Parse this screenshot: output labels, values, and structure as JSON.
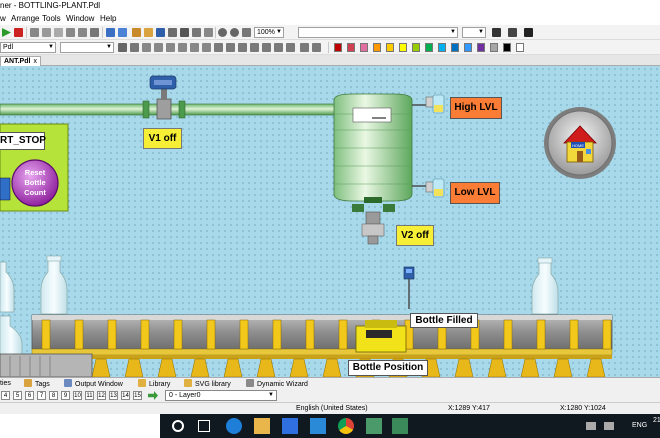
{
  "window": {
    "title": "ner - BOTTLING-PLANT.Pdl"
  },
  "menu": {
    "items": [
      "w",
      "Arrange",
      "Tools",
      "Window",
      "Help"
    ]
  },
  "toolbar": {
    "zoom": "100%",
    "filename_combo": "Pdl"
  },
  "colors": {
    "palette": [
      "#c00000",
      "#d04050",
      "#e070a0",
      "#ff9900",
      "#ffcc00",
      "#ffff00",
      "#99cc00",
      "#00b050",
      "#00b0f0",
      "#0070c0",
      "#3399ff",
      "#7030a0",
      "#a6a6a6",
      "#000000",
      "#ffffff"
    ],
    "canvas_bg": "#a7d9ea",
    "orange": "#fb7d35",
    "yellow": "#f6ef36"
  },
  "doc_tab": {
    "label": "ANT.Pdl",
    "close": "x"
  },
  "scene": {
    "start_stop_button": "RT_STOP",
    "reset_button": [
      "Reset",
      "Bottle",
      "Count"
    ],
    "valve1_label": "V1 off",
    "valve2_label": "V2 off",
    "high_level_label": "High LVL",
    "low_level_label": "Low LVL",
    "home_icon_text": "HOME",
    "bottle_filled_label": "Bottle Filled",
    "bottle_position_label": "Bottle Position"
  },
  "panel_tabs": [
    "ties",
    "Tags",
    "Output Window",
    "Library",
    "SVG library",
    "Dynamic Wizard"
  ],
  "pages": [
    "4",
    "5",
    "6",
    "7",
    "8",
    "9",
    "10",
    "11",
    "12",
    "13",
    "14",
    "15"
  ],
  "layer": "0 - Layer0",
  "status": {
    "language": "English (United States)",
    "cursor": "X:1289 Y:417",
    "resolution": "X:1280 Y:1024"
  },
  "taskbar": {
    "lang": "ENG",
    "clock": "21"
  }
}
